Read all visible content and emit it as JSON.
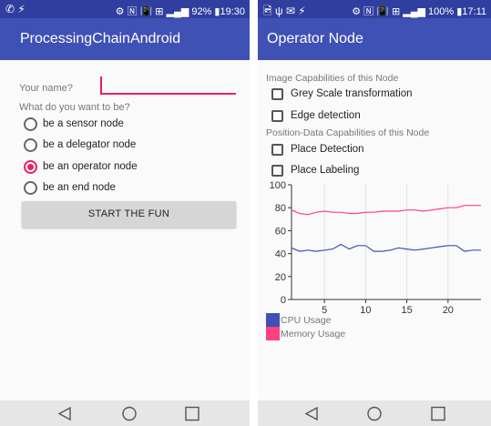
{
  "left_screen": {
    "status_bar": {
      "left_icons": "✆ ⚡",
      "right_text": "⚙ 🄽 📳 ⊞ ▂▄▆ 92% ▮19:30"
    },
    "app_title": "ProcessingChainAndroid",
    "name_label": "Your name?",
    "role_question": "What do you want to be?",
    "roles": [
      {
        "label": "be a sensor node",
        "checked": false
      },
      {
        "label": "be a delegator node",
        "checked": false
      },
      {
        "label": "be an operator node",
        "checked": true
      },
      {
        "label": "be an end node",
        "checked": false
      }
    ],
    "start_button": "START THE FUN"
  },
  "right_screen": {
    "status_bar": {
      "left_icons": "🖻 ψ ✉ ⚡",
      "right_text": "⚙ 🄽 📳 ⊞ ▂▄▆ 100% ▮17:11"
    },
    "app_title": "Operator Node",
    "image_section": "Image Capabilities of this Node",
    "image_options": [
      {
        "label": "Grey Scale transformation",
        "checked": false
      },
      {
        "label": "Edge detection",
        "checked": false
      }
    ],
    "position_section": "Position-Data Capabilities of this Node",
    "position_options": [
      {
        "label": "Place Detection",
        "checked": false
      },
      {
        "label": "Place Labeling",
        "checked": false
      }
    ]
  },
  "nav_icons": [
    "back-icon",
    "home-icon",
    "recents-icon"
  ],
  "colors": {
    "primary": "#3F51B5",
    "primary_dark": "#303F9F",
    "accent": "#E91E63",
    "cpu": "#3F51B5",
    "memory": "#FF4081"
  },
  "chart_data": {
    "type": "line",
    "title": "",
    "xlabel": "",
    "ylabel": "",
    "xlim": [
      1,
      24
    ],
    "ylim": [
      0,
      100
    ],
    "x_ticks": [
      5,
      10,
      15,
      20
    ],
    "y_ticks": [
      0,
      20,
      40,
      60,
      80,
      100
    ],
    "grid": "vertical",
    "legend_position": "bottom-left",
    "x": [
      1,
      2,
      3,
      4,
      5,
      6,
      7,
      8,
      9,
      10,
      11,
      12,
      13,
      14,
      15,
      16,
      17,
      18,
      19,
      20,
      21,
      22,
      23,
      24
    ],
    "series": [
      {
        "name": "CPU Usage",
        "color": "#3F51B5",
        "values": [
          45,
          42,
          43,
          42,
          43,
          44,
          48,
          44,
          47,
          47,
          42,
          42,
          43,
          45,
          44,
          43,
          44,
          45,
          46,
          47,
          47,
          42,
          43,
          43
        ]
      },
      {
        "name": "Memory Usage",
        "color": "#FF4081",
        "values": [
          78,
          75,
          74,
          76,
          77,
          76,
          76,
          75,
          75,
          76,
          76,
          77,
          77,
          77,
          78,
          78,
          77,
          78,
          79,
          80,
          80,
          82,
          82,
          82
        ]
      }
    ]
  }
}
